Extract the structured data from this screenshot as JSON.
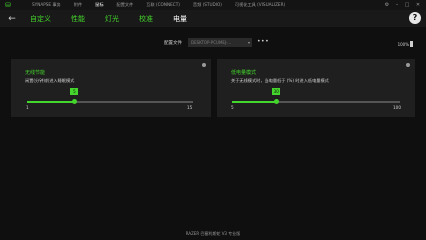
{
  "app": {
    "tabs": [
      "SYNAPSE 事务",
      "附件",
      "鼠标",
      "配置文件",
      "互联 (CONNECT)",
      "音频 (STUDIO)",
      "可视化工具 (VISUALIZER)"
    ],
    "active_tab": 2
  },
  "subnav": {
    "tabs": [
      "自定义",
      "性能",
      "灯光",
      "校准",
      "电量"
    ],
    "active_tab": 4
  },
  "profile": {
    "label": "配置文件",
    "value": "DESKTOP-PCUMEJ-...",
    "more": "•••",
    "battery": "100%"
  },
  "cards": [
    {
      "title": "无线节能",
      "desc": "闲置(分钟)前进入睡眠模式",
      "min": "1",
      "max": "15",
      "value": 5,
      "min_value": 1,
      "max_value": 15
    },
    {
      "title": "低电量模式",
      "desc": "关于无线模式时，当电量低于 (%) 时进入低电量模式",
      "min": "5",
      "max": "100",
      "value": 30,
      "min_value": 5,
      "max_value": 100
    }
  ],
  "footer": "RAZER 巴塞利斯蛇 V3 专业版",
  "colors": {
    "accent": "#44d62c"
  }
}
